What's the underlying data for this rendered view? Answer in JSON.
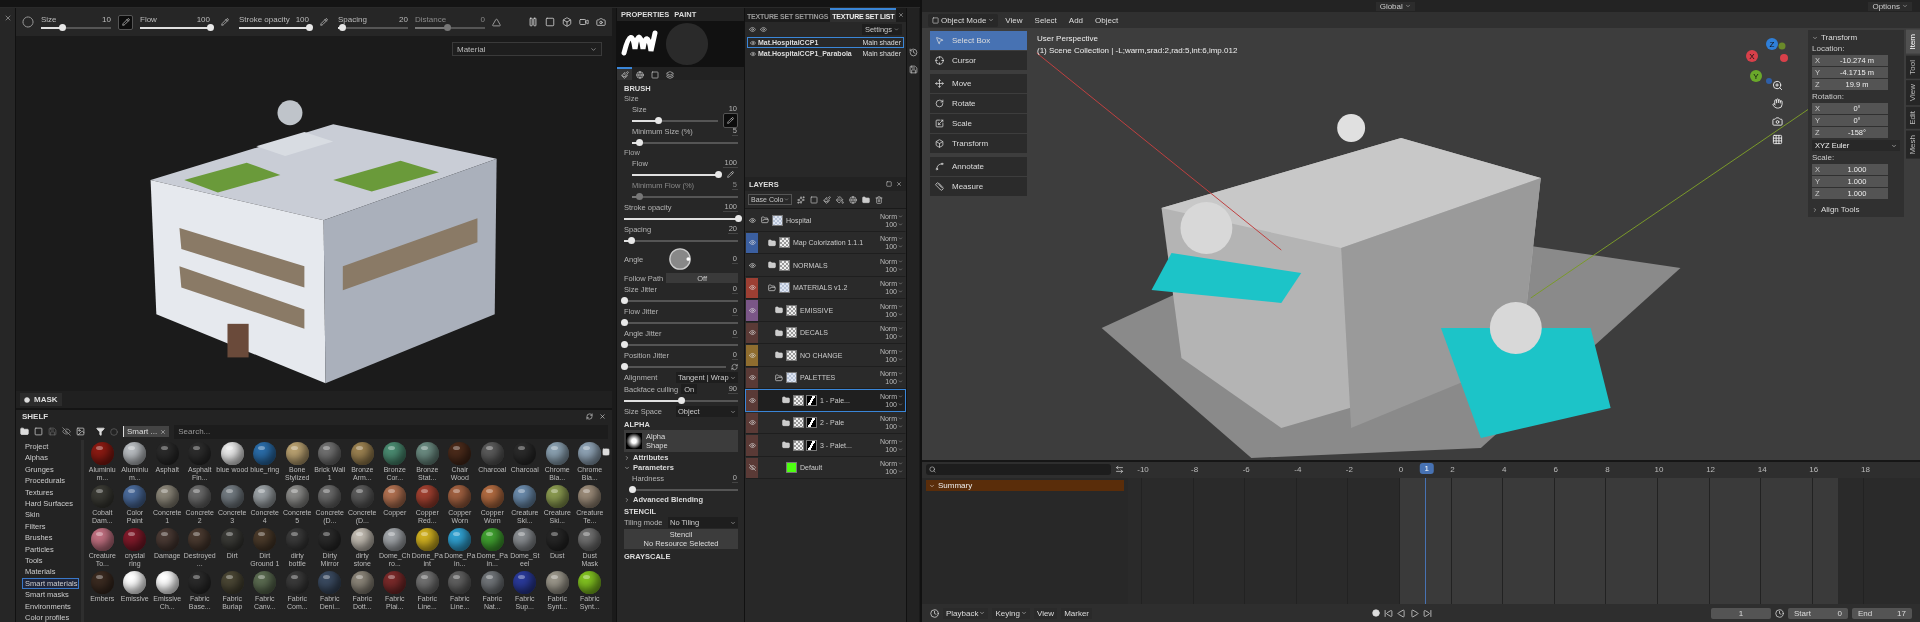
{
  "painter": {
    "tool_options": {
      "sliders": [
        {
          "label": "Size",
          "value": "10",
          "level": 0.3,
          "pressure": true
        },
        {
          "label": "Flow",
          "value": "100",
          "level": 1,
          "pressure": false
        },
        {
          "label": "Stroke opacity",
          "value": "100",
          "level": 1,
          "pressure": false
        },
        {
          "label": "Spacing",
          "value": "20",
          "level": 0.05
        },
        {
          "label": "Distance",
          "value": "0",
          "level": 0.45,
          "disabled": true
        }
      ]
    },
    "viewport": {
      "display_mode": "Material"
    },
    "mask_bar": {
      "label": "MASK"
    },
    "shelf": {
      "title": "SHELF",
      "filter_tag": "Smart ...",
      "search_placeholder": "Search...",
      "categories": [
        {
          "label": "Project",
          "selected": false
        },
        {
          "label": "Alphas",
          "selected": false
        },
        {
          "label": "Grunges",
          "selected": false
        },
        {
          "label": "Procedurals",
          "selected": false
        },
        {
          "label": "Textures",
          "selected": false
        },
        {
          "label": "Hard Surfaces",
          "selected": false
        },
        {
          "label": "Skin",
          "selected": false
        },
        {
          "label": "Filters",
          "selected": false
        },
        {
          "label": "Brushes",
          "selected": false
        },
        {
          "label": "Particles",
          "selected": false
        },
        {
          "label": "Tools",
          "selected": false
        },
        {
          "label": "Materials",
          "selected": false
        },
        {
          "label": "Smart materials",
          "selected": true
        },
        {
          "label": "Smart masks",
          "selected": false
        },
        {
          "label": "Environments",
          "selected": false
        },
        {
          "label": "Color profiles",
          "selected": false
        }
      ],
      "materials": [
        {
          "name": "Aluminium...",
          "color": "#8a1a12"
        },
        {
          "name": "Aluminium...",
          "color": "#b8bcc0"
        },
        {
          "name": "Asphalt",
          "color": "#2a2a2a"
        },
        {
          "name": "Asphalt Fin...",
          "color": "#2c2c2c"
        },
        {
          "name": "blue wood",
          "color": "#e8e8e8"
        },
        {
          "name": "blue_ring",
          "color": "#2a6ca8"
        },
        {
          "name": "Bone Stylized",
          "color": "#b8a070"
        },
        {
          "name": "Brick Wall 1",
          "color": "#707070"
        },
        {
          "name": "Bronze Arm...",
          "color": "#9a8050"
        },
        {
          "name": "Bronze Cor...",
          "color": "#4a8a70"
        },
        {
          "name": "Bronze Stat...",
          "color": "#6a8a80"
        },
        {
          "name": "Chair Wood",
          "color": "#4a2a1a"
        },
        {
          "name": "Charcoal",
          "color": "#5a5a5a"
        },
        {
          "name": "Charcoal",
          "color": "#2a2a2a"
        },
        {
          "name": "Chrome Bla...",
          "color": "#8aa0b0"
        },
        {
          "name": "Chrome Bla...",
          "color": "#8ea2b4"
        },
        {
          "name": "Cobalt Dam...",
          "color": "#3a3a34"
        },
        {
          "name": "Color Paint",
          "color": "#4a6a9a"
        },
        {
          "name": "Concrete 1",
          "color": "#8a8578"
        },
        {
          "name": "Concrete 2",
          "color": "#6a6a6a"
        },
        {
          "name": "Concrete 3",
          "color": "#727a80"
        },
        {
          "name": "Concrete 4",
          "color": "#9aa0a4"
        },
        {
          "name": "Concrete 5",
          "color": "#8a8a88"
        },
        {
          "name": "Concrete (D...",
          "color": "#6a6a6a"
        },
        {
          "name": "Concrete (D...",
          "color": "#5a5a5a"
        },
        {
          "name": "Copper",
          "color": "#b07050"
        },
        {
          "name": "Copper Red...",
          "color": "#a04030"
        },
        {
          "name": "Copper Worn",
          "color": "#a06040"
        },
        {
          "name": "Copper Worn",
          "color": "#b06a40"
        },
        {
          "name": "Creature Ski...",
          "color": "#6a8aaa"
        },
        {
          "name": "Creature Ski...",
          "color": "#8a9a50"
        },
        {
          "name": "Creature Te...",
          "color": "#9a8a78"
        },
        {
          "name": "Creature To...",
          "color": "#c07080"
        },
        {
          "name": "crystal ring",
          "color": "#801a2a"
        },
        {
          "name": "Damage",
          "color": "#4a3a34"
        },
        {
          "name": "Destroyed ...",
          "color": "#4a3a30"
        },
        {
          "name": "Dirt",
          "color": "#3a3a36"
        },
        {
          "name": "Dirt Ground 1",
          "color": "#4a3a2a"
        },
        {
          "name": "dirty bottle",
          "color": "#3a3a3a"
        },
        {
          "name": "Dirty Mirror",
          "color": "#2a2a2a"
        },
        {
          "name": "dirty stone",
          "color": "#c0bab0"
        },
        {
          "name": "Dome_Chro...",
          "color": "#a0a4a8"
        },
        {
          "name": "Dome_Paint",
          "color": "#d0b020"
        },
        {
          "name": "Dome_Pain...",
          "color": "#30a0d0"
        },
        {
          "name": "Dome_Pain...",
          "color": "#40a030"
        },
        {
          "name": "Dome_Steel",
          "color": "#888c90"
        },
        {
          "name": "Dust",
          "color": "#262626"
        },
        {
          "name": "Dust Mask",
          "color": "#707070"
        },
        {
          "name": "Embers",
          "color": "#3a2a20"
        },
        {
          "name": "Emissive",
          "color": "#ffffff"
        },
        {
          "name": "Emissive Ch...",
          "color": "#fefefe"
        },
        {
          "name": "Fabric Base...",
          "color": "#2a2a2a"
        },
        {
          "name": "Fabric Burlap",
          "color": "#4a4634"
        },
        {
          "name": "Fabric Canv...",
          "color": "#5a6a50"
        },
        {
          "name": "Fabric Com...",
          "color": "#3a3a3a"
        },
        {
          "name": "Fabric Deni...",
          "color": "#3a4a60"
        },
        {
          "name": "Fabric Dott...",
          "color": "#8a8478"
        },
        {
          "name": "Fabric Plai...",
          "color": "#7a2a2a"
        },
        {
          "name": "Fabric Line...",
          "color": "#717171"
        },
        {
          "name": "Fabric Line...",
          "color": "#606060"
        },
        {
          "name": "Fabric Nat...",
          "color": "#707478"
        },
        {
          "name": "Fabric Sup...",
          "color": "#2a3a9a"
        },
        {
          "name": "Fabric Synt...",
          "color": "#9a968a"
        },
        {
          "name": "Fabric Synt...",
          "color": "#80c020"
        }
      ]
    },
    "properties": {
      "title": "PROPERTIES",
      "mode": "PAINT",
      "tool_tabs": [
        {
          "kind": "brush",
          "selected": true
        },
        {
          "kind": "material",
          "selected": false
        },
        {
          "kind": "alpha",
          "selected": false
        },
        {
          "kind": "stencil",
          "selected": false
        }
      ],
      "brush": {
        "title": "BRUSH",
        "rows": [
          {
            "kind": "group",
            "label": "Size",
            "children": [
              {
                "kind": "slider",
                "label": "Size",
                "value": "10",
                "level": 0.3,
                "pressure": true
              },
              {
                "kind": "slider",
                "label": "Minimum Size (%)",
                "value": "5",
                "level": 0.07
              }
            ]
          },
          {
            "kind": "group",
            "label": "Flow",
            "children": [
              {
                "kind": "slider",
                "label": "Flow",
                "value": "100",
                "level": 1,
                "pressure": false
              },
              {
                "kind": "slider",
                "label": "Minimum Flow (%)",
                "value": "5",
                "level": 0.07,
                "disabled": true
              }
            ]
          },
          {
            "kind": "slider",
            "label": "Stroke opacity",
            "value": "100",
            "level": 1
          },
          {
            "kind": "slider",
            "label": "Spacing",
            "value": "20",
            "level": 0.06
          },
          {
            "kind": "dial",
            "label": "Angle",
            "value": "0"
          },
          {
            "kind": "toggle",
            "label": "Follow Path",
            "value": "Off"
          },
          {
            "kind": "slider",
            "label": "Size Jitter",
            "value": "0",
            "level": 0
          },
          {
            "kind": "slider",
            "label": "Flow Jitter",
            "value": "0",
            "level": 0
          },
          {
            "kind": "slider",
            "label": "Angle Jitter",
            "value": "0",
            "level": 0
          },
          {
            "kind": "slider",
            "label": "Position Jitter",
            "value": "0",
            "level": 0,
            "seed": true
          },
          {
            "kind": "dropdown",
            "label": "Alignment",
            "value": "Tangent | Wrap"
          },
          {
            "kind": "toggle_slider",
            "label": "Backface culling",
            "toggle": "On",
            "value": "90",
            "level": 0.5
          },
          {
            "kind": "dropdown",
            "label": "Size Space",
            "value": "Object"
          }
        ]
      },
      "alpha": {
        "title": "ALPHA",
        "name": "Alpha",
        "shape": "Shape",
        "sections": [
          {
            "label": "Attributes",
            "expanded": false
          },
          {
            "label": "Parameters",
            "expanded": true,
            "sliders": [
              {
                "label": "Hardness",
                "value": "0",
                "level": 0
              }
            ]
          },
          {
            "label": "Advanced Blending",
            "expanded": false
          }
        ]
      },
      "stencil": {
        "title": "STENCIL",
        "tiling_label": "Tiling mode",
        "tiling_value": "No Tiling",
        "button": "Stencil",
        "button_note": "No Resource Selected"
      },
      "grayscale": {
        "title": "GRAYSCALE"
      }
    },
    "texture_sets": {
      "tabs": [
        {
          "label": "TEXTURE SET SETTINGS",
          "selected": false
        },
        {
          "label": "TEXTURE SET LIST",
          "selected": true
        }
      ],
      "settings": "Settings",
      "items": [
        {
          "name": "Mat.HospitalCCP1",
          "shader": "Main shader",
          "selected": true
        },
        {
          "name": "Mat.HospitalCCP1_Parabola",
          "shader": "Main shader",
          "selected": false
        }
      ]
    },
    "layers": {
      "title": "LAYERS",
      "channel": "Base Colo",
      "items": [
        {
          "name": "Hospital",
          "kind": "folder",
          "expanded": true,
          "visible": true,
          "selected": false,
          "blend": "Norm",
          "opacity": "100",
          "children": [
            {
              "name": "Map Colorization 1.1.1",
              "kind": "folder",
              "expanded": false,
              "visible": true,
              "selected": false,
              "color": "#3b5fa0",
              "blend": "Norm",
              "opacity": "100"
            },
            {
              "name": "NORMALS",
              "kind": "folder",
              "expanded": false,
              "visible": true,
              "selected": false,
              "blend": "Norm",
              "opacity": "100"
            },
            {
              "name": "MATERIALS v1.2",
              "kind": "folder",
              "expanded": true,
              "visible": true,
              "selected": false,
              "color": "#9c3f33",
              "blend": "Norm",
              "opacity": "100",
              "children": [
                {
                  "name": "EMISSIVE",
                  "kind": "folder",
                  "expanded": false,
                  "visible": true,
                  "selected": false,
                  "color": "#7a5687",
                  "blend": "Norm",
                  "opacity": "100"
                },
                {
                  "name": "DECALS",
                  "kind": "folder",
                  "expanded": false,
                  "visible": true,
                  "selected": false,
                  "color": "#5a3a36",
                  "blend": "Norm",
                  "opacity": "100"
                },
                {
                  "name": "NO CHANGE",
                  "kind": "folder",
                  "expanded": false,
                  "visible": true,
                  "selected": false,
                  "color": "#8f6d2f",
                  "blend": "Norm",
                  "opacity": "100"
                },
                {
                  "name": "PALETTES",
                  "kind": "folder",
                  "expanded": true,
                  "visible": true,
                  "selected": false,
                  "color": "#5a3a36",
                  "blend": "Norm",
                  "opacity": "100",
                  "children": [
                    {
                      "name": "1 - Pale...",
                      "kind": "folder",
                      "expanded": false,
                      "visible": true,
                      "selected": true,
                      "color": "#5a3a36",
                      "mask": true,
                      "blend": "Norm",
                      "opacity": "100"
                    },
                    {
                      "name": "2 - Pale",
                      "kind": "folder",
                      "expanded": false,
                      "visible": true,
                      "selected": false,
                      "color": "#5a3a36",
                      "mask": true,
                      "blend": "Norm",
                      "opacity": "100"
                    },
                    {
                      "name": "3 - Palet...",
                      "kind": "folder",
                      "expanded": false,
                      "visible": true,
                      "selected": false,
                      "color": "#5a3a36",
                      "mask": true,
                      "blend": "Norm",
                      "opacity": "100"
                    }
                  ]
                },
                {
                  "name": "Default",
                  "kind": "fill",
                  "visible": false,
                  "selected": false,
                  "color": "#5a3a36",
                  "blend": "Norm",
                  "opacity": "100"
                }
              ]
            }
          ]
        }
      ]
    }
  },
  "blender": {
    "topbar": {
      "orientation": "Global",
      "options": "Options"
    },
    "header": {
      "mode": "Object Mode",
      "menus": [
        "View",
        "Select",
        "Add",
        "Object"
      ]
    },
    "tool_groups": [
      {
        "tools": [
          {
            "label": "Select Box",
            "kind": "select",
            "selected": true
          },
          {
            "label": "Cursor",
            "kind": "cursor",
            "selected": false
          }
        ]
      },
      {
        "tools": [
          {
            "label": "Move",
            "kind": "move",
            "selected": false
          },
          {
            "label": "Rotate",
            "kind": "rotate",
            "selected": false
          },
          {
            "label": "Scale",
            "kind": "scale",
            "selected": false
          },
          {
            "label": "Transform",
            "kind": "transform",
            "selected": false
          }
        ]
      },
      {
        "tools": [
          {
            "label": "Annotate",
            "kind": "annotate",
            "selected": false
          },
          {
            "label": "Measure",
            "kind": "measure",
            "selected": false
          }
        ]
      }
    ],
    "overlay": {
      "view": "User Perspective",
      "collection": "(1) Scene Collection | -L;warm,srad:2,rad:5,int:6,imp.012"
    },
    "gizmo": {
      "z": "Z",
      "x": "X",
      "y": "Y"
    },
    "sidebar": {
      "tabs": [
        {
          "label": "Item",
          "selected": true
        },
        {
          "label": "Tool",
          "selected": false
        },
        {
          "label": "View",
          "selected": false
        },
        {
          "label": "Edit",
          "selected": false
        },
        {
          "label": "Mesh",
          "selected": false
        }
      ],
      "panel": "Transform",
      "groups": [
        {
          "label": "Location:",
          "fields": [
            {
              "axis": "X",
              "value": "-10.274 m"
            },
            {
              "axis": "Y",
              "value": "-4.1715 m"
            },
            {
              "axis": "Z",
              "value": "19.9 m"
            }
          ]
        },
        {
          "label": "Rotation:",
          "fields": [
            {
              "axis": "X",
              "value": "0°"
            },
            {
              "axis": "Y",
              "value": "0°"
            },
            {
              "axis": "Z",
              "value": "-158°"
            }
          ],
          "mode": "XYZ Euler"
        },
        {
          "label": "Scale:",
          "fields": [
            {
              "axis": "X",
              "value": "1.000"
            },
            {
              "axis": "Y",
              "value": "1.000"
            },
            {
              "axis": "Z",
              "value": "1.000"
            }
          ]
        }
      ],
      "align": "Align Tools"
    },
    "timeline": {
      "ticks": [
        "-10",
        "-8",
        "-6",
        "-4",
        "-2",
        "0",
        "2",
        "4",
        "6",
        "8",
        "10",
        "12",
        "14",
        "16",
        "18"
      ],
      "current_frame": "1",
      "channel": "Summary",
      "menus": [
        {
          "label": "Playback",
          "dropdown": true
        },
        {
          "label": "Keying",
          "dropdown": true
        },
        {
          "label": "View",
          "dropdown": false
        },
        {
          "label": "Marker",
          "dropdown": false
        }
      ],
      "frame": "1",
      "start_label": "Start",
      "start": "0",
      "end_label": "End",
      "end": "17"
    }
  }
}
